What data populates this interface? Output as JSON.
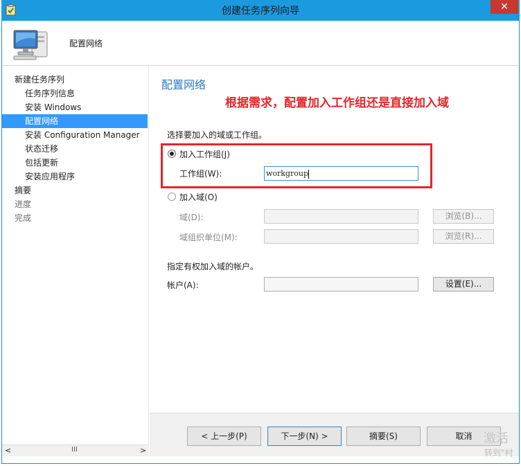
{
  "window": {
    "title": "创建任务序列向导",
    "close_glyph": "✕"
  },
  "header": {
    "title": "配置网络"
  },
  "sidebar": {
    "items": [
      {
        "label": "新建任务序列"
      },
      {
        "label": "任务序列信息"
      },
      {
        "label": "安装 Windows"
      },
      {
        "label": "配置网络"
      },
      {
        "label": "安装 Configuration Manager"
      },
      {
        "label": "状态迁移"
      },
      {
        "label": "包括更新"
      },
      {
        "label": "安装应用程序"
      },
      {
        "label": "摘要"
      },
      {
        "label": "进度"
      },
      {
        "label": "完成"
      }
    ],
    "selected_index": 3,
    "scrollbar": {
      "left_arrow": "<",
      "thumb_glyph": "III",
      "right_arrow": ">"
    }
  },
  "main": {
    "section_title": "配置网络",
    "annotation": "根据需求，配置加入工作组还是直接加入域",
    "join_prompt": "选择要加入的域或工作组。",
    "workgroup_option": "加入工作组(J)",
    "workgroup_label": "工作组(W):",
    "workgroup_value": "workgroup",
    "domain_option": "加入域(O)",
    "domain_label": "域(D):",
    "domain_browse": "浏览(B)...",
    "ou_label": "域组织单位(M):",
    "ou_browse": "浏览(R)...",
    "account_prompt": "指定有权加入域的帐户。",
    "account_label": "帐户(A):",
    "account_set": "设置(E)..."
  },
  "footer": {
    "prev": "< 上一步(P)",
    "next": "下一步(N) >",
    "summary": "摘要(S)",
    "cancel": "取消"
  },
  "watermark": {
    "line1": "激活",
    "line2": "转到\"村"
  },
  "colors": {
    "titlebar": "#1b9ae0",
    "selected": "#3399ff",
    "annotation_red": "#e3262b",
    "section_blue": "#2b7bc2"
  }
}
